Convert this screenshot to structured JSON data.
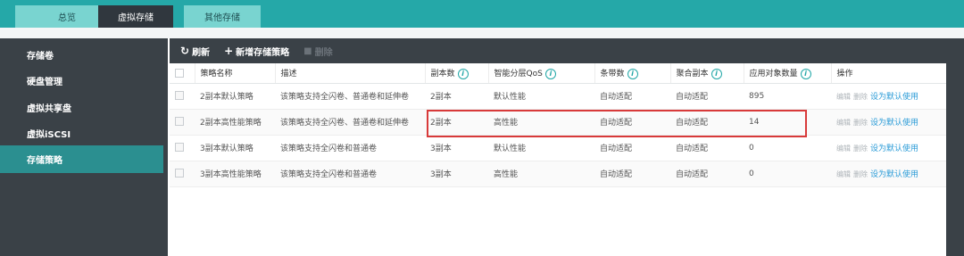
{
  "top_tabs": [
    {
      "label": "总览"
    },
    {
      "label": "虚拟存储"
    },
    {
      "label": "其他存储"
    }
  ],
  "sidebar": {
    "items": [
      {
        "label": "存储卷"
      },
      {
        "label": "硬盘管理"
      },
      {
        "label": "虚拟共享盘"
      },
      {
        "label": "虚拟iSCSI"
      },
      {
        "label": "存储策略"
      }
    ],
    "active_index": 4
  },
  "toolbar": {
    "refresh_label": "刷新",
    "add_label": "新增存储策略",
    "delete_label": "删除"
  },
  "table": {
    "headers": {
      "name": "策略名称",
      "desc": "描述",
      "replicas": "副本数",
      "qos": "智能分层QoS",
      "stripes": "条带数",
      "agg_replica": "聚合副本",
      "objects": "应用对象数量",
      "ops": "操作"
    },
    "rows": [
      {
        "name": "2副本默认策略",
        "desc": "该策略支持全闪卷、普通卷和延伸卷",
        "replicas": "2副本",
        "qos": "默认性能",
        "stripes": "自动适配",
        "agg_replica": "自动适配",
        "objects": "895"
      },
      {
        "name": "2副本高性能策略",
        "desc": "该策略支持全闪卷、普通卷和延伸卷",
        "replicas": "2副本",
        "qos": "高性能",
        "stripes": "自动适配",
        "agg_replica": "自动适配",
        "objects": "14"
      },
      {
        "name": "3副本默认策略",
        "desc": "该策略支持全闪卷和普通卷",
        "replicas": "3副本",
        "qos": "默认性能",
        "stripes": "自动适配",
        "agg_replica": "自动适配",
        "objects": "0"
      },
      {
        "name": "3副本高性能策略",
        "desc": "该策略支持全闪卷和普通卷",
        "replicas": "3副本",
        "qos": "高性能",
        "stripes": "自动适配",
        "agg_replica": "自动适配",
        "objects": "0"
      }
    ],
    "ops": {
      "edit": "编辑",
      "delete": "删除",
      "set_default": "设为默认使用"
    }
  },
  "highlighted_row_index": 1,
  "colors": {
    "accent": "#25a8a8",
    "sidebar_bg": "#3a4147",
    "active_item": "#2b8f90",
    "highlight": "#d83a3a",
    "link": "#2a9bd7"
  }
}
